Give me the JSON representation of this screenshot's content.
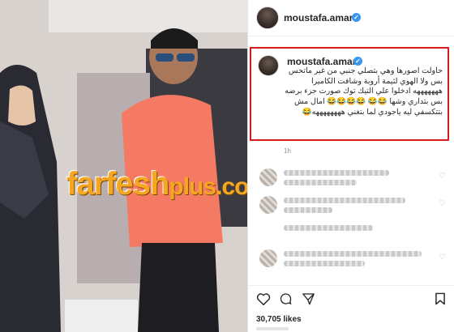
{
  "post": {
    "username": "moustafa.amar",
    "verified_mark": "✓",
    "caption": "حاولت اصورها وهي بتصلي جنبي من غير ماتحس بس ولا الهوي لثيمة أروبة وشافت الكاميرا هههههههه ادخلوا علي التيك توك صورت جزء برضه بس بتداري وشها 😂😂 😂😂😂😂 امال مش بتتكسفي ليه ياجودي لما بتغني ههههههههه😂",
    "time": "1h",
    "likes": "30,705 likes"
  },
  "watermark": {
    "main": "farfesh",
    "plus": "plus.com"
  },
  "icons": [
    "heart-icon",
    "comment-icon",
    "share-icon",
    "bookmark-icon"
  ],
  "colors": {
    "highlight_border": "#d51c1c",
    "verified": "#3897f0",
    "watermark": "#f5a623"
  }
}
